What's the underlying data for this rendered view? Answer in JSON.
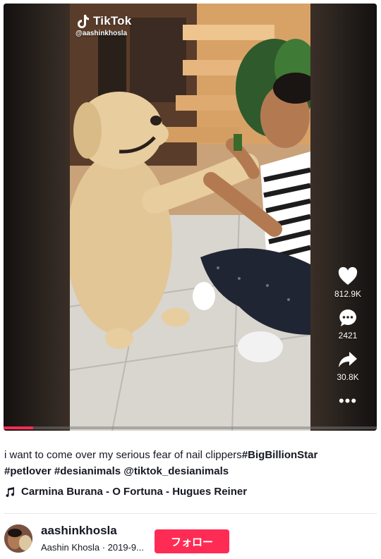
{
  "video": {
    "brand": "TikTok",
    "watermark_handle": "@aashinkhosla",
    "progress_percent": 8
  },
  "actions": {
    "like_count": "812.9K",
    "comment_count": "2421",
    "share_count": "30.8K",
    "more_glyph": "•••"
  },
  "caption": {
    "text": "i want to come over my serious fear of nail clippers",
    "tags": [
      "#BigBillionStar",
      "#petlover",
      "#desianimals",
      "@tiktok_desianimals"
    ]
  },
  "music": {
    "title": "Carmina Burana - O Fortuna - Hugues Reiner"
  },
  "author": {
    "username": "aashinkhosla",
    "meta": "Aashin Khosla · 2019-9..."
  },
  "follow_label": "フォロー",
  "colors": {
    "accent": "#fe2c55",
    "text": "#161823"
  },
  "icons": [
    "tiktok-logo-icon",
    "heart-icon",
    "comment-icon",
    "share-icon",
    "more-icon",
    "music-note-icon"
  ]
}
